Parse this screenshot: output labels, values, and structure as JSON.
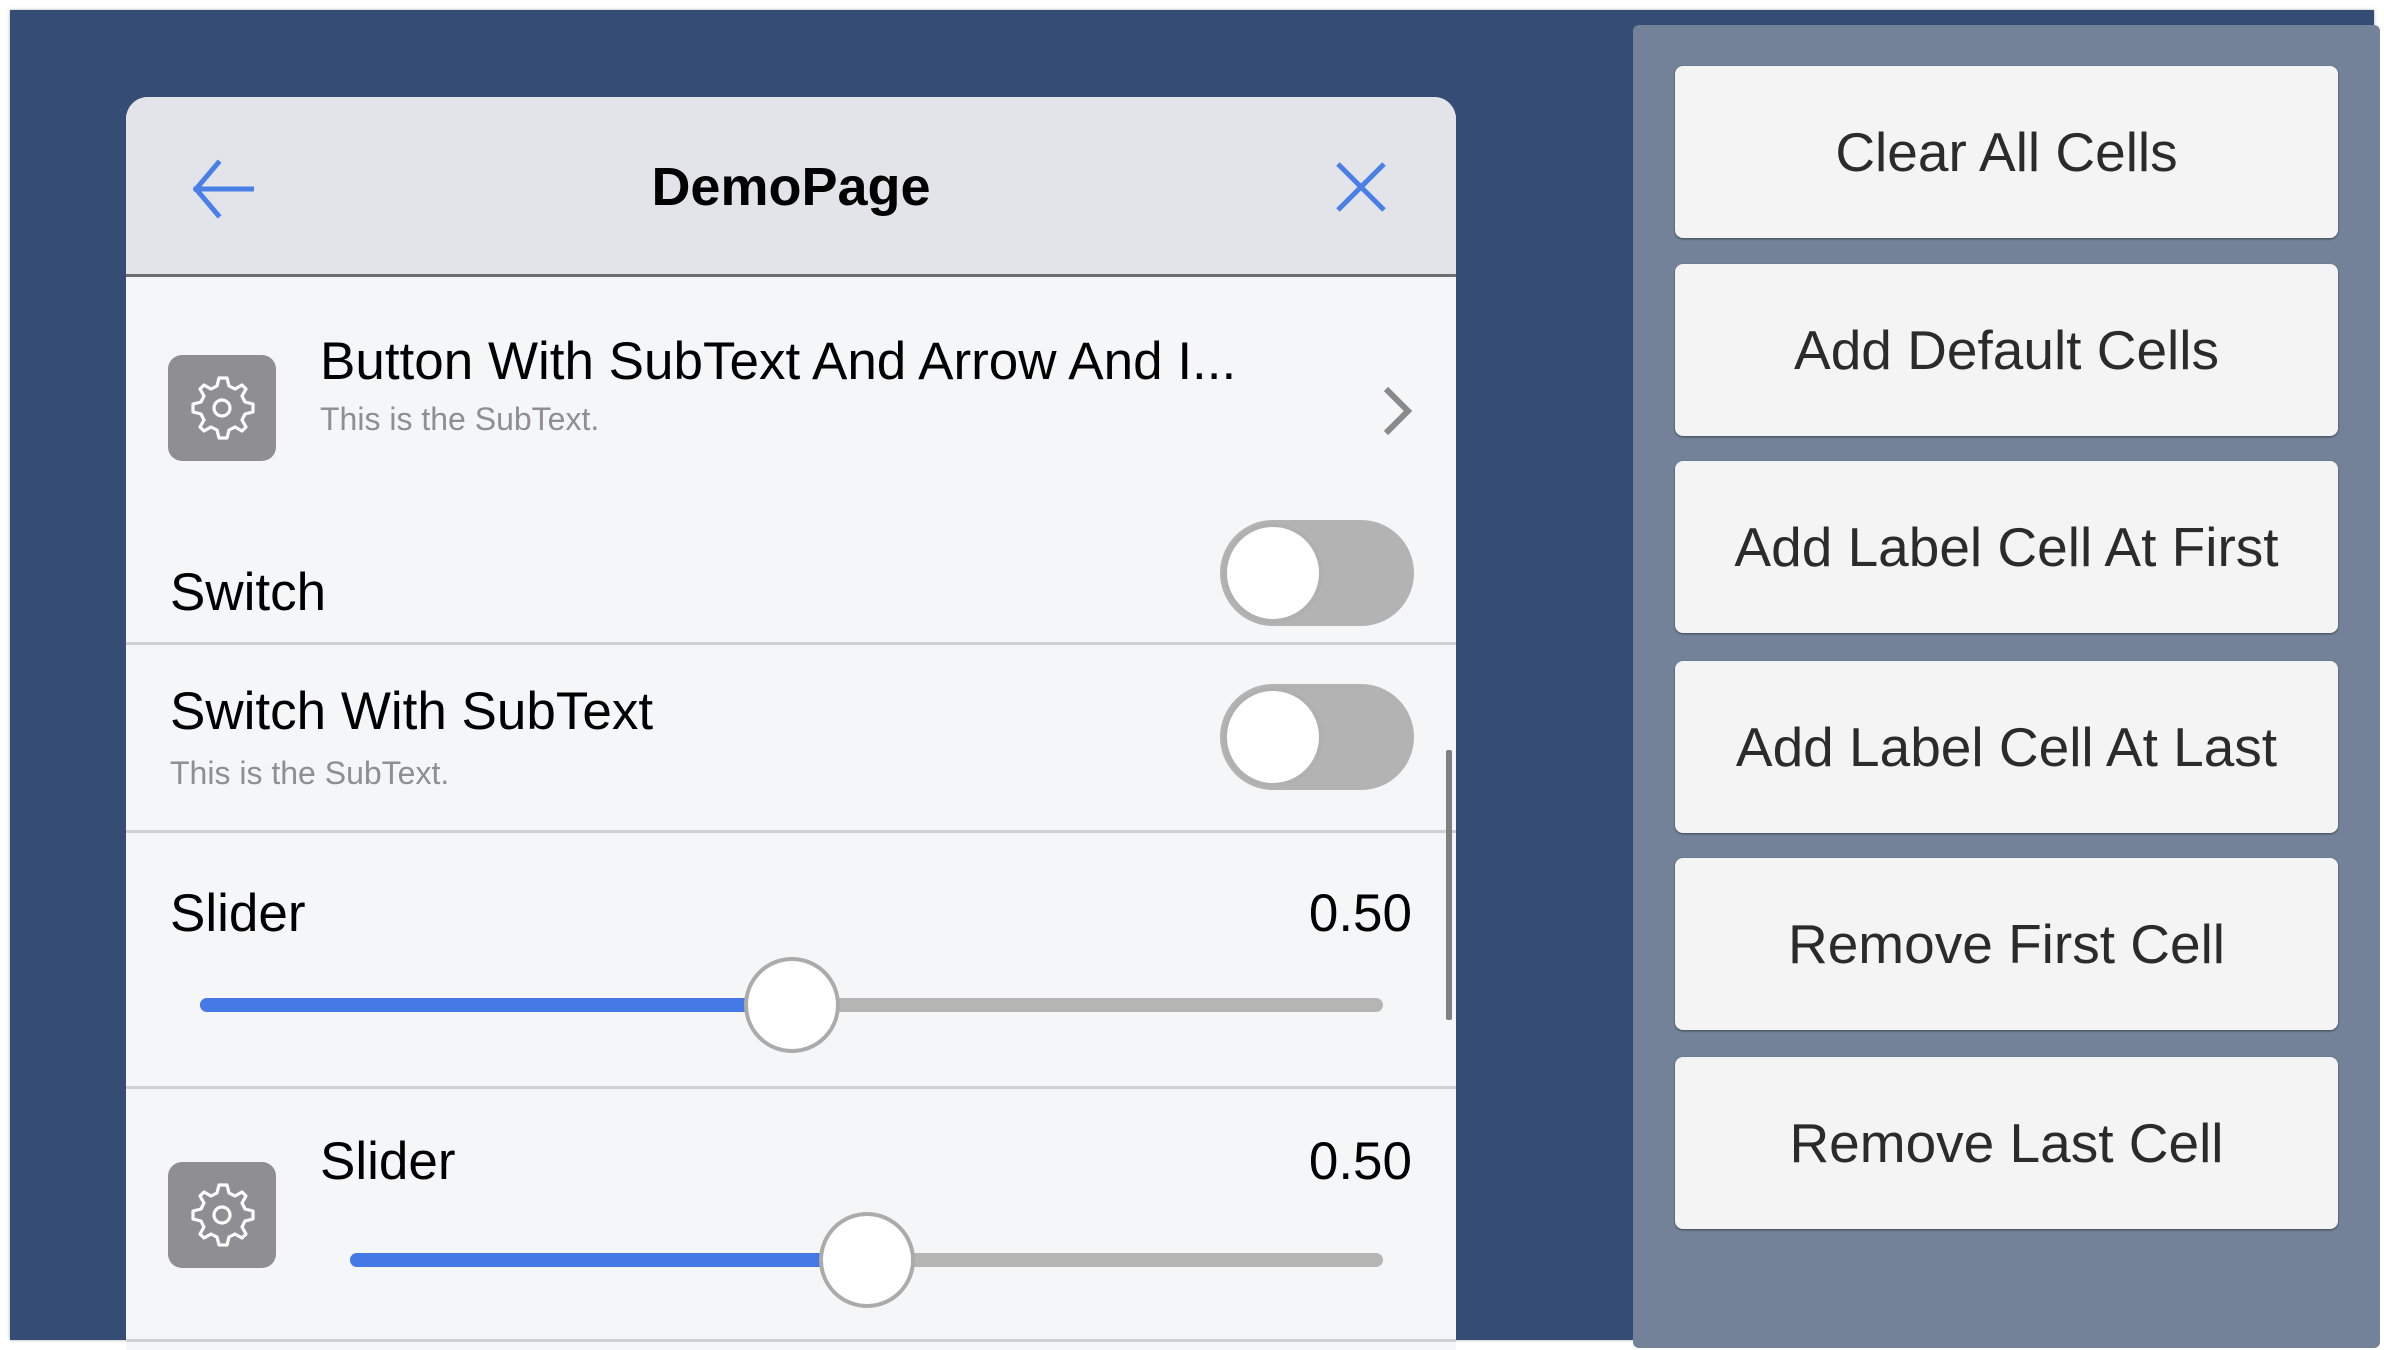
{
  "page": {
    "title": "DemoPage",
    "back_icon": "arrow-left-icon",
    "close_icon": "close-x-icon",
    "accent_color": "#4579e6"
  },
  "cells": {
    "button": {
      "icon": "gear-icon",
      "title": "Button With SubText And Arrow And I...",
      "subtext": "This is the SubText.",
      "accessory": "chevron-right-icon"
    },
    "switch": {
      "title": "Switch",
      "on": false
    },
    "switch_sub": {
      "title": "Switch With SubText",
      "subtext": "This is the SubText.",
      "on": false
    },
    "slider": {
      "title": "Slider",
      "value_text": "0.50",
      "value": 0.5
    },
    "slider_icon": {
      "icon": "gear-icon",
      "title": "Slider",
      "value_text": "0.50",
      "value": 0.5
    }
  },
  "controls": {
    "buttons": [
      {
        "label": "Clear All Cells"
      },
      {
        "label": "Add Default Cells"
      },
      {
        "label": "Add Label Cell At First"
      },
      {
        "label": "Add Label Cell At Last"
      },
      {
        "label": "Remove First Cell"
      },
      {
        "label": "Remove Last Cell"
      }
    ]
  }
}
